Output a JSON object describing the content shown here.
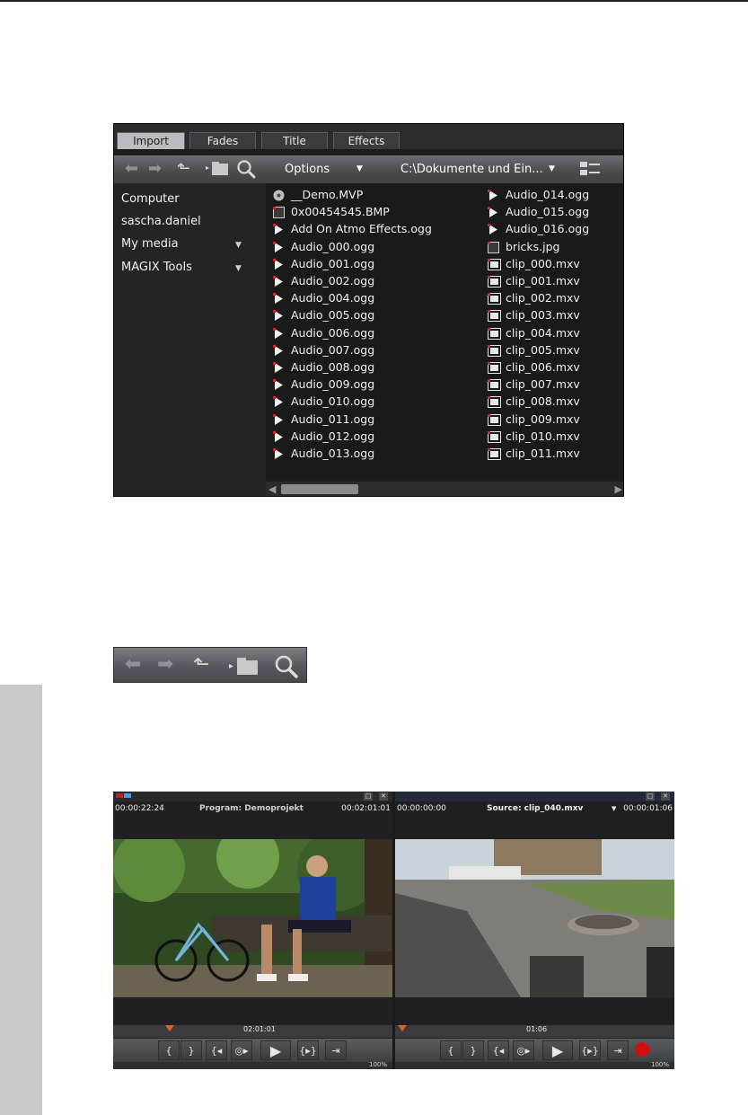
{
  "media_pool": {
    "tabs": [
      {
        "label": "Import",
        "active": true
      },
      {
        "label": "Fades",
        "active": false
      },
      {
        "label": "Title",
        "active": false
      },
      {
        "label": "Effects",
        "active": false
      }
    ],
    "toolbar": {
      "back_icon": "arrow-left-icon",
      "forward_icon": "arrow-right-icon",
      "up_icon": "folder-up-icon",
      "new_folder_icon": "new-folder-icon",
      "search_icon": "search-icon",
      "options_label": "Options",
      "path_value": "C:\\Dokumente und Ein...",
      "view_icon": "view-mode-icon"
    },
    "nav": [
      {
        "label": "Computer",
        "dropdown": false
      },
      {
        "label": "sascha.daniel",
        "dropdown": false
      },
      {
        "label": "My media",
        "dropdown": true
      },
      {
        "label": "MAGIX Tools",
        "dropdown": true
      }
    ],
    "files_col1": [
      {
        "name": "__Demo.MVP",
        "icon": "project-icon"
      },
      {
        "name": "0x00454545.BMP",
        "icon": "image-icon"
      },
      {
        "name": "Add On Atmo Effects.ogg",
        "icon": "audio-icon"
      },
      {
        "name": "Audio_000.ogg",
        "icon": "audio-icon"
      },
      {
        "name": "Audio_001.ogg",
        "icon": "audio-icon"
      },
      {
        "name": "Audio_002.ogg",
        "icon": "audio-icon"
      },
      {
        "name": "Audio_004.ogg",
        "icon": "audio-icon"
      },
      {
        "name": "Audio_005.ogg",
        "icon": "audio-icon"
      },
      {
        "name": "Audio_006.ogg",
        "icon": "audio-icon"
      },
      {
        "name": "Audio_007.ogg",
        "icon": "audio-icon"
      },
      {
        "name": "Audio_008.ogg",
        "icon": "audio-icon"
      },
      {
        "name": "Audio_009.ogg",
        "icon": "audio-icon"
      },
      {
        "name": "Audio_010.ogg",
        "icon": "audio-icon"
      },
      {
        "name": "Audio_011.ogg",
        "icon": "audio-icon"
      },
      {
        "name": "Audio_012.ogg",
        "icon": "audio-icon"
      },
      {
        "name": "Audio_013.ogg",
        "icon": "audio-icon"
      }
    ],
    "files_col2": [
      {
        "name": "Audio_014.ogg",
        "icon": "audio-icon"
      },
      {
        "name": "Audio_015.ogg",
        "icon": "audio-icon"
      },
      {
        "name": "Audio_016.ogg",
        "icon": "audio-icon"
      },
      {
        "name": "bricks.jpg",
        "icon": "image-icon"
      },
      {
        "name": "clip_000.mxv",
        "icon": "video-icon"
      },
      {
        "name": "clip_001.mxv",
        "icon": "video-icon"
      },
      {
        "name": "clip_002.mxv",
        "icon": "video-icon"
      },
      {
        "name": "clip_003.mxv",
        "icon": "video-icon"
      },
      {
        "name": "clip_004.mxv",
        "icon": "video-icon"
      },
      {
        "name": "clip_005.mxv",
        "icon": "video-icon"
      },
      {
        "name": "clip_006.mxv",
        "icon": "video-icon"
      },
      {
        "name": "clip_007.mxv",
        "icon": "video-icon"
      },
      {
        "name": "clip_008.mxv",
        "icon": "video-icon"
      },
      {
        "name": "clip_009.mxv",
        "icon": "video-icon"
      },
      {
        "name": "clip_010.mxv",
        "icon": "video-icon"
      },
      {
        "name": "clip_011.mxv",
        "icon": "video-icon"
      }
    ]
  },
  "nav_strip": {
    "icons": [
      "arrow-left-icon",
      "arrow-right-icon",
      "folder-up-icon",
      "new-folder-icon",
      "search-icon"
    ]
  },
  "monitors": {
    "program": {
      "time_left": "00:00:22:24",
      "title": "Program: Demoprojekt",
      "time_right": "00:02:01:01",
      "timeline_label": "02:01:01",
      "zoom": "100%",
      "buttons": [
        "{",
        "}",
        "{◂",
        "◎▸",
        "▶",
        "{▸}",
        "⇥"
      ]
    },
    "source": {
      "time_left": "00:00:00:00",
      "title": "Source: clip_040.mxv",
      "time_right": "00:00:01:06",
      "timeline_label": "01:06",
      "zoom": "100%",
      "buttons": [
        "{",
        "}",
        "{◂",
        "◎▸",
        "▶",
        "{▸}",
        "⇥"
      ]
    }
  },
  "colors": {
    "panel_bg": "#1b1c1e",
    "record": "#d01010",
    "playhead": "#e06020",
    "side_strip": "#c8c8c8"
  }
}
